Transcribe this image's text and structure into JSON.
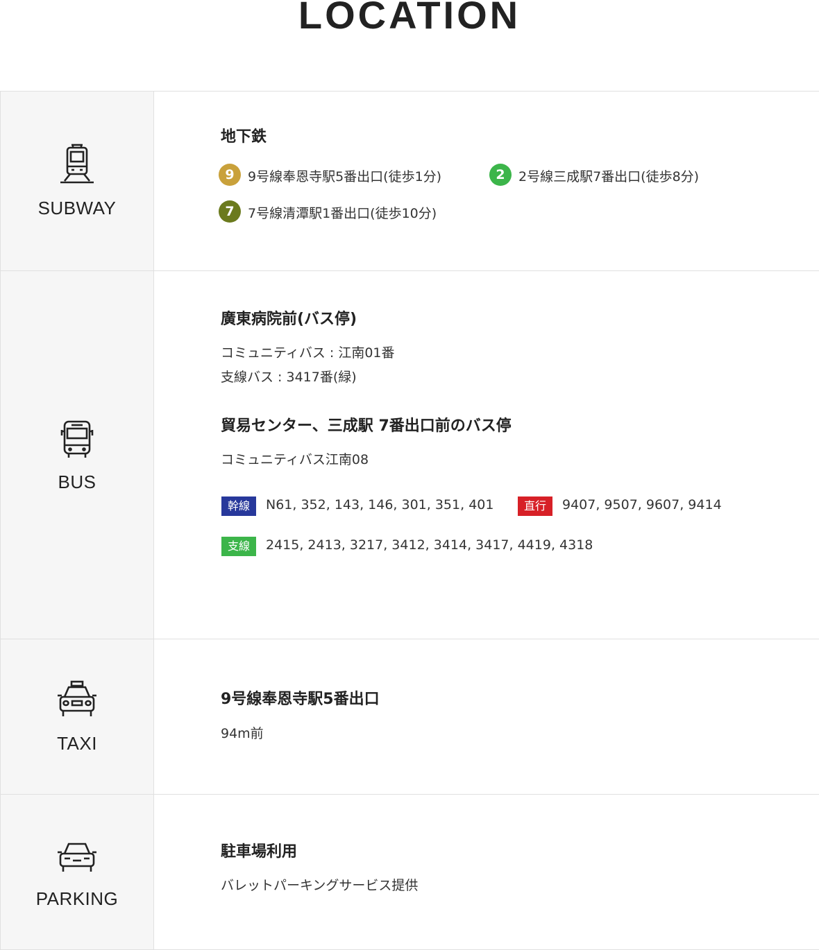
{
  "title": "LOCATION",
  "subway": {
    "label": "SUBWAY",
    "heading": "地下鉄",
    "lines": [
      {
        "badge": "9",
        "color": "#c9a13b",
        "text": "9号線奉恩寺駅5番出口(徒歩1分)"
      },
      {
        "badge": "2",
        "color": "#3cb54a",
        "text": "2号線三成駅7番出口(徒歩8分)"
      },
      {
        "badge": "7",
        "color": "#6b7a1d",
        "text": "7号線清潭駅1番出口(徒歩10分)"
      }
    ]
  },
  "bus": {
    "label": "BUS",
    "stop1": {
      "heading": "廣東病院前(バス停)",
      "line1": "コミュニティバス : 江南01番",
      "line2": "支線バス : 3417番(緑)"
    },
    "stop2": {
      "heading": "貿易センター、三成駅 7番出口前のバス停",
      "line1": "コミュニティバス江南08"
    },
    "routes": [
      {
        "tag": "幹線",
        "color": "#27389b",
        "numbers": "N61, 352, 143, 146, 301, 351, 401"
      },
      {
        "tag": "直行",
        "color": "#d72027",
        "numbers": "9407, 9507, 9607, 9414"
      },
      {
        "tag": "支線",
        "color": "#3cb54a",
        "numbers": "2415, 2413, 3217, 3412, 3414, 3417, 4419, 4318"
      }
    ]
  },
  "taxi": {
    "label": "TAXI",
    "heading": "9号線奉恩寺駅5番出口",
    "text": "94m前"
  },
  "parking": {
    "label": "PARKING",
    "heading": "駐車場利用",
    "text": "バレットパーキングサービス提供"
  },
  "icons": [
    "train-icon",
    "bus-icon",
    "taxi-icon",
    "car-icon"
  ]
}
